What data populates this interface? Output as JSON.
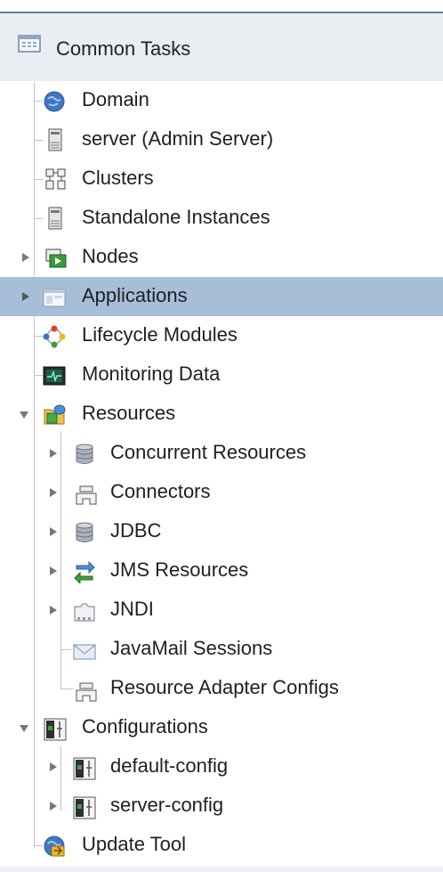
{
  "tree": {
    "header": {
      "title": "Common Tasks",
      "icon": "table-icon"
    },
    "items": [
      {
        "label": "Domain",
        "icon": "globe-icon",
        "toggle": "none"
      },
      {
        "label": "server (Admin Server)",
        "icon": "server-icon",
        "toggle": "none"
      },
      {
        "label": "Clusters",
        "icon": "cluster-icon",
        "toggle": "none"
      },
      {
        "label": "Standalone Instances",
        "icon": "server-icon",
        "toggle": "none"
      },
      {
        "label": "Nodes",
        "icon": "node-icon",
        "toggle": "collapsed"
      },
      {
        "label": "Applications",
        "icon": "window-icon",
        "toggle": "collapsed",
        "selected": true
      },
      {
        "label": "Lifecycle Modules",
        "icon": "lifecycle-icon",
        "toggle": "none"
      },
      {
        "label": "Monitoring Data",
        "icon": "monitor-icon",
        "toggle": "none"
      },
      {
        "label": "Resources",
        "icon": "resources-icon",
        "toggle": "expanded"
      },
      {
        "label": "Concurrent Resources",
        "icon": "database-icon",
        "toggle": "collapsed"
      },
      {
        "label": "Connectors",
        "icon": "connector-icon",
        "toggle": "collapsed"
      },
      {
        "label": "JDBC",
        "icon": "database-icon",
        "toggle": "collapsed"
      },
      {
        "label": "JMS Resources",
        "icon": "jms-arrows-icon",
        "toggle": "collapsed"
      },
      {
        "label": "JNDI",
        "icon": "jndi-icon",
        "toggle": "collapsed"
      },
      {
        "label": "JavaMail Sessions",
        "icon": "envelope-icon",
        "toggle": "none"
      },
      {
        "label": "Resource Adapter Configs",
        "icon": "connector-icon",
        "toggle": "none"
      },
      {
        "label": "Configurations",
        "icon": "config-icon",
        "toggle": "expanded"
      },
      {
        "label": "default-config",
        "icon": "config-icon",
        "toggle": "collapsed"
      },
      {
        "label": "server-config",
        "icon": "config-icon",
        "toggle": "collapsed"
      },
      {
        "label": "Update Tool",
        "icon": "update-tool-icon",
        "toggle": "none"
      }
    ]
  },
  "colors": {
    "selected_row": "#a7bed9",
    "header_bg": "#eaeef3",
    "top_border": "#5f7898"
  }
}
